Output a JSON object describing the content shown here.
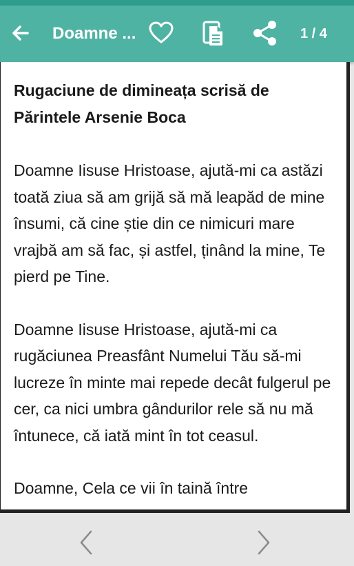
{
  "colors": {
    "appbar": "#4fb3a4",
    "statusbar": "#2f9d8c",
    "text": "#1a1a1a",
    "bottombar": "#e6e6e6"
  },
  "appbar": {
    "title": "Doamne ...",
    "page_counter": "1 / 4",
    "icons": [
      "arrow-back-icon",
      "heart-outline-icon",
      "copy-document-icon",
      "share-icon"
    ]
  },
  "content": {
    "heading": "Rugaciune de dimineața scrisă de Părintele Arsenie Boca",
    "paragraphs": [
      "Doamne Iisuse Hristoase, ajută-mi ca astăzi toată ziua să am grijă să mă leapăd de mine însumi, că cine știe din ce nimicuri mare vrajbă am să fac, și astfel, ținând la mine, Te pierd pe Tine.",
      "Doamne Iisuse Hristoase, ajută-mi ca rugăciunea Preasfânt Numelui Tău să-mi lucreze în minte mai repede decât fulgerul pe cer, ca nici umbra gândurilor rele să nu mă întunece, că iată mint în tot ceasul.",
      "Doamne, Cela ce vii în taină între"
    ]
  },
  "bottom_nav": {
    "icons": [
      "chevron-left-icon",
      "chevron-right-icon"
    ]
  }
}
